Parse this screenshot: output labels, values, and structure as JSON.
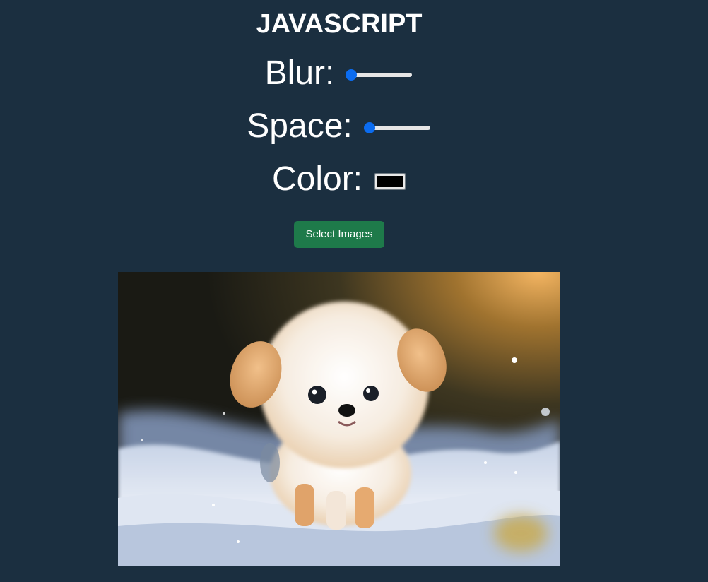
{
  "header": {
    "title": "JAVASCRIPT"
  },
  "controls": {
    "blur": {
      "label": "Blur:",
      "value_fraction": 0.0
    },
    "space": {
      "label": "Space:",
      "value_fraction": 0.0
    },
    "color": {
      "label": "Color:",
      "value": "#000000"
    }
  },
  "actions": {
    "select_images_label": "Select Images"
  },
  "preview": {
    "image_subject": "puppy-in-snow"
  },
  "theme": {
    "background": "#1b2f40",
    "accent": "#0b6cf0",
    "button": "#1e7a4a"
  }
}
